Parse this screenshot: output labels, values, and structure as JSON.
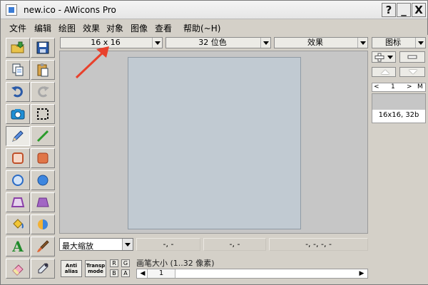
{
  "window": {
    "title": "new.ico - AWicons Pro",
    "help_button": "?",
    "minimize_button": "_",
    "close_button": "X"
  },
  "menu": {
    "items": [
      "文件",
      "编辑",
      "绘图",
      "效果",
      "对象",
      "图像",
      "查看",
      "帮助(~H)"
    ]
  },
  "toolbar": {
    "size_combo": "16 x 16",
    "color_depth_combo": "32 位色",
    "effects_combo": "效果"
  },
  "toolbox": {
    "selected_tool": "pencil-tool",
    "text_tool_glyph": "A"
  },
  "status": {
    "zoom_select": "最大缩放",
    "cell_1": "-, -",
    "cell_2": "-, -",
    "cell_3": "-, -, -, -",
    "antialias_button": "Anti alias",
    "transparent_mode_button": "Transp mode",
    "r_button": "R",
    "g_button": "G",
    "b_button": "B",
    "a_button": "A",
    "pen_size_label": "画笔大小 (1..32 像素)",
    "pen_size_value": "1"
  },
  "right_panel": {
    "type_combo": "图标",
    "nav_prev": "<",
    "nav_page": "1",
    "nav_next": ">",
    "nav_m": "M",
    "icon_caption": "16x16, 32b"
  },
  "colors": {
    "canvas": "#c1cad2",
    "workspace": "#c6c6c6",
    "annotation_arrow": "#e8412c"
  }
}
